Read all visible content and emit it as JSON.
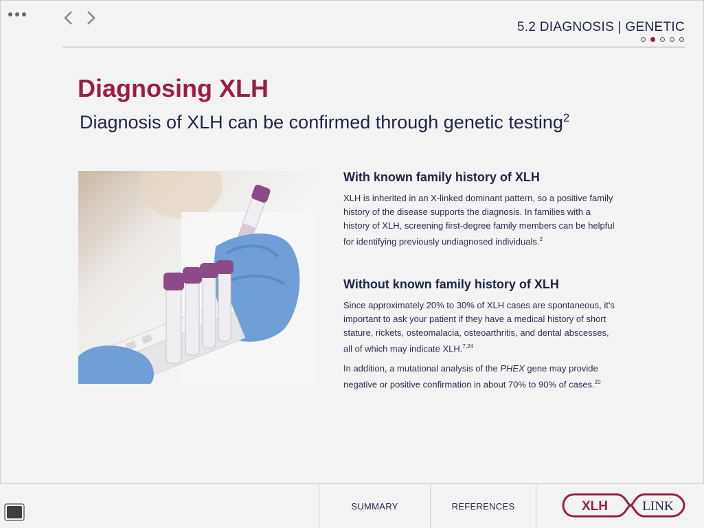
{
  "header": {
    "section_title": "5.2 DIAGNOSIS | GENETIC",
    "pager": {
      "total": 5,
      "active_index": 1
    }
  },
  "main": {
    "title": "Diagnosing XLH",
    "subtitle": "Diagnosis of XLH can be confirmed through genetic testing",
    "subtitle_ref": "2",
    "section1": {
      "heading": "With known family history of XLH",
      "text": "XLH is inherited in an X-linked dominant pattern, so a positive family history of the disease supports the diagnosis. In families with a history of XLH, screening first-degree family members can be helpful for identifying previously undiagnosed individuals.",
      "ref": "2"
    },
    "section2": {
      "heading": "Without known family history of XLH",
      "text1": "Since approximately 20% to 30% of XLH cases are spontaneous, it's important to ask your patient if they have a medical history of short stature, rickets, osteomalacia, osteoarthritis, and dental abscesses, all of which may indicate XLH.",
      "ref1": "7,24",
      "text2_before": "In addition, a mutational analysis of the ",
      "text2_gene": "PHEX",
      "text2_after": " gene may provide negative or positive confirmation in about 70% to 90% of cases.",
      "ref2": "20"
    }
  },
  "footer": {
    "summary": "SUMMARY",
    "references": "REFERENCES",
    "logo_left": "XLH",
    "logo_right": "LINK"
  },
  "colors": {
    "accent": "#9b1d45",
    "navy": "#1f2444",
    "glove": "#6f9fd6"
  }
}
